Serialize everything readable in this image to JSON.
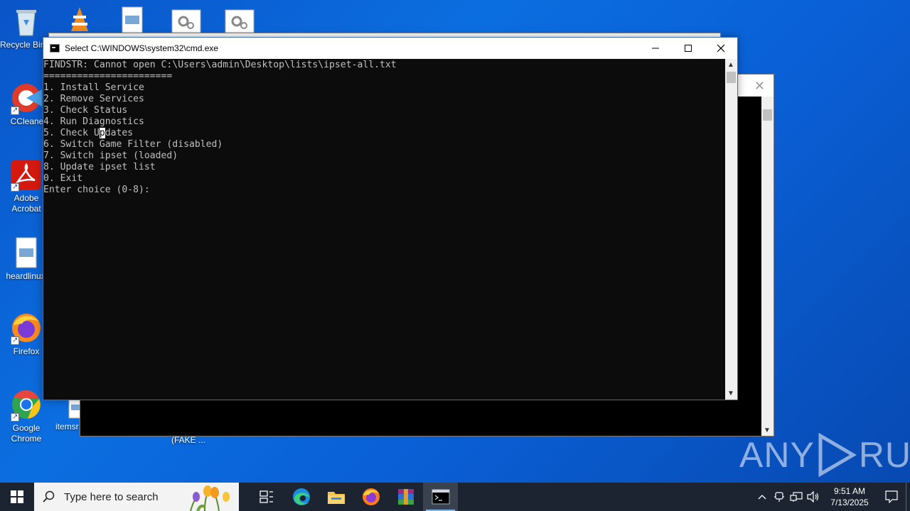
{
  "desktop": {
    "icons": [
      {
        "label": "Recycle Bin"
      },
      {
        "label": "CCleaner"
      },
      {
        "label": "Adobe Acrobat"
      },
      {
        "label": "heardlinux"
      },
      {
        "label": "Firefox"
      },
      {
        "label": "Google Chrome"
      },
      {
        "label": "itemsr"
      }
    ],
    "fake_label": "(FAKE ..."
  },
  "cmd_window": {
    "title": "Select C:\\WINDOWS\\system32\\cmd.exe",
    "lines": [
      "FINDSTR: Cannot open C:\\Users\\admin\\Desktop\\lists\\ipset-all.txt",
      "=======================",
      "1. Install Service",
      "2. Remove Services",
      "3. Check Status",
      "4. Run Diagnostics",
      "6. Switch Game Filter (disabled)",
      "7. Switch ipset (loaded)",
      "8. Update ipset list",
      "0. Exit",
      "Enter choice (0-8):"
    ],
    "line5_before": "5. Check U",
    "line5_caret": "p",
    "line5_after": "dates"
  },
  "watermark": {
    "left": "ANY",
    "right": "RUN"
  },
  "taskbar": {
    "search_placeholder": "Type here to search",
    "clock_time": "9:51 AM",
    "clock_date": "7/13/2025"
  },
  "colors": {
    "desktop": "#0a60d6",
    "taskbar": "#1b2430",
    "console_bg": "#0c0c0c",
    "console_text": "#c0c0c0"
  }
}
